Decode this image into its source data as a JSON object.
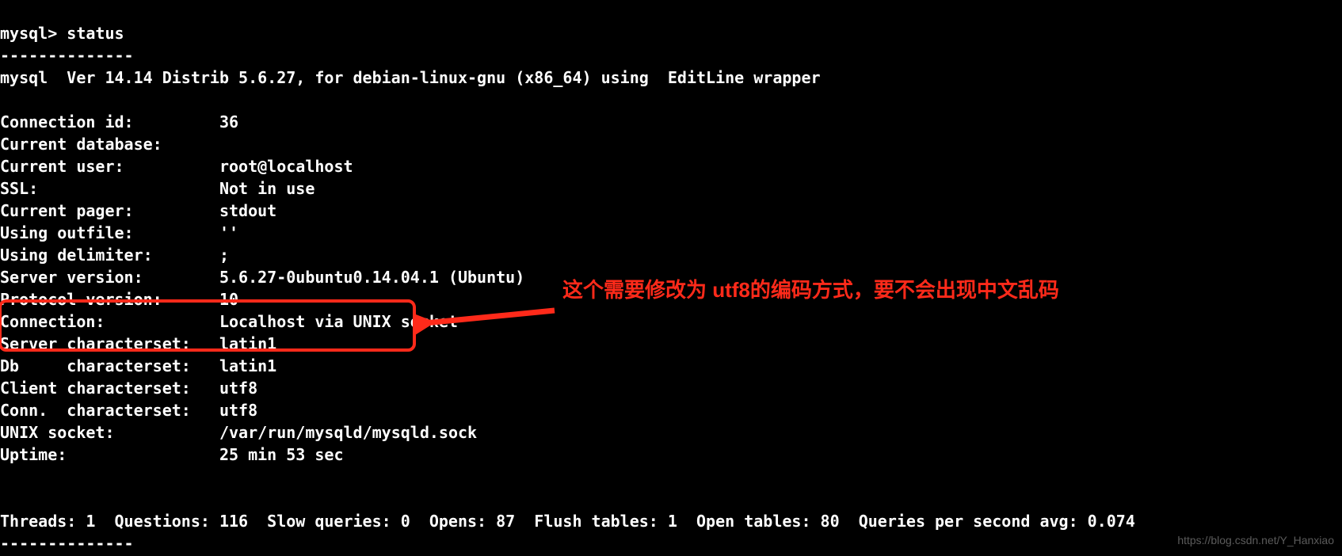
{
  "prompt": "mysql> ",
  "command": "status",
  "divider_top": "--------------",
  "version_line": "mysql  Ver 14.14 Distrib 5.6.27, for debian-linux-gnu (x86_64) using  EditLine wrapper",
  "rows": [
    {
      "label": "Connection id:",
      "value": "36"
    },
    {
      "label": "Current database:",
      "value": ""
    },
    {
      "label": "Current user:",
      "value": "root@localhost"
    },
    {
      "label": "SSL:",
      "value": "Not in use"
    },
    {
      "label": "Current pager:",
      "value": "stdout"
    },
    {
      "label": "Using outfile:",
      "value": "''"
    },
    {
      "label": "Using delimiter:",
      "value": ";"
    },
    {
      "label": "Server version:",
      "value": "5.6.27-0ubuntu0.14.04.1 (Ubuntu)"
    },
    {
      "label": "Protocol version:",
      "value": "10"
    },
    {
      "label": "Connection:",
      "value": "Localhost via UNIX socket"
    },
    {
      "label": "Server characterset:",
      "value": "latin1"
    },
    {
      "label": "Db     characterset:",
      "value": "latin1"
    },
    {
      "label": "Client characterset:",
      "value": "utf8"
    },
    {
      "label": "Conn.  characterset:",
      "value": "utf8"
    },
    {
      "label": "UNIX socket:",
      "value": "/var/run/mysqld/mysqld.sock"
    },
    {
      "label": "Uptime:",
      "value": "25 min 53 sec"
    }
  ],
  "stats_line": "Threads: 1  Questions: 116  Slow queries: 0  Opens: 87  Flush tables: 1  Open tables: 80  Queries per second avg: 0.074",
  "divider_bottom": "--------------",
  "annotation_text": "这个需要修改为 utf8的编码方式，要不会出现中文乱码",
  "watermark": "https://blog.csdn.net/Y_Hanxiao"
}
